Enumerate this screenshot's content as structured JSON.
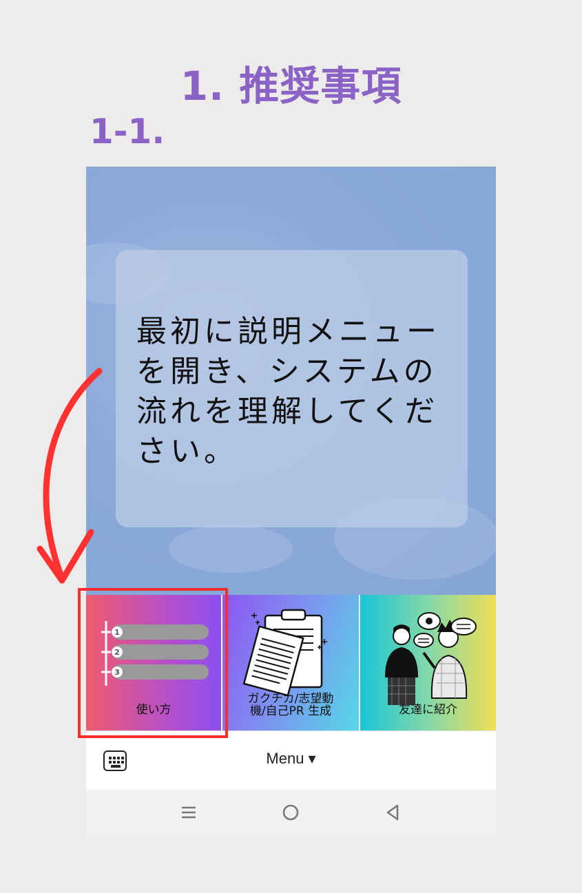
{
  "heading": {
    "title": "1. 推奨事項",
    "step": "1-1."
  },
  "rich_menu": {
    "notice": "最初に説明メニューを開き、システムの流れを理解してください。",
    "tiles": [
      {
        "label": "使い方",
        "icon": "numbered-list-icon"
      },
      {
        "label": "ガクチカ/志望動\n機/自己PR 生成",
        "label_line1": "ガクチカ/志望動",
        "label_line2": "機/自己PR 生成",
        "icon": "clipboard-documents-icon"
      },
      {
        "label": "友達に紹介",
        "icon": "people-talking-icon"
      }
    ],
    "list_numbers": [
      "1",
      "2",
      "3"
    ]
  },
  "bottom_bar": {
    "menu_label": "Menu ▾",
    "keyboard_icon": "keyboard-icon"
  },
  "nav_bar": {
    "icons": [
      "recent-apps-icon",
      "home-icon",
      "back-icon"
    ]
  },
  "colors": {
    "accent_purple": "#8b63c6",
    "highlight_red": "#ff2d2d",
    "sky_blue": "#8aa9da"
  }
}
